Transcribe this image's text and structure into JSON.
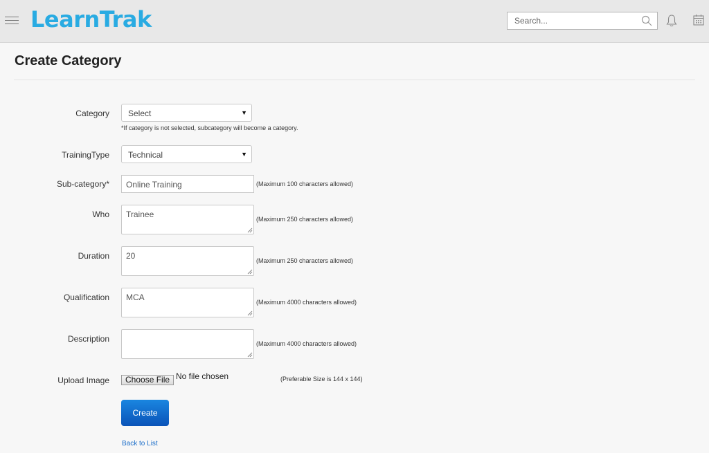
{
  "header": {
    "logo": "LearnTrak",
    "search_placeholder": "Search..."
  },
  "page": {
    "title": "Create Category"
  },
  "form": {
    "category": {
      "label": "Category",
      "value": "Select",
      "note": "*If category is not selected, subcategory will become a category."
    },
    "training_type": {
      "label": "TrainingType",
      "value": "Technical"
    },
    "sub_category": {
      "label": "Sub-category*",
      "value": "Online Training",
      "hint": "(Maximum 100 characters allowed)"
    },
    "who": {
      "label": "Who",
      "value": "Trainee",
      "hint": "(Maximum 250 characters allowed)"
    },
    "duration": {
      "label": "Duration",
      "value": "20",
      "hint": "(Maximum 250 characters allowed)"
    },
    "qualification": {
      "label": "Qualification",
      "value": "MCA",
      "hint": "(Maximum 4000 characters allowed)"
    },
    "description": {
      "label": "Description",
      "value": "",
      "hint": "(Maximum 4000 characters allowed)"
    },
    "upload_image": {
      "label": "Upload Image",
      "button": "Choose File",
      "status": "No file chosen",
      "hint": "(Preferable Size is 144 x 144)"
    }
  },
  "actions": {
    "create": "Create",
    "back": "Back to List"
  },
  "colors": {
    "brand": "#29abe2",
    "primary_button": "#0a53b8",
    "link": "#1a6dc9"
  }
}
